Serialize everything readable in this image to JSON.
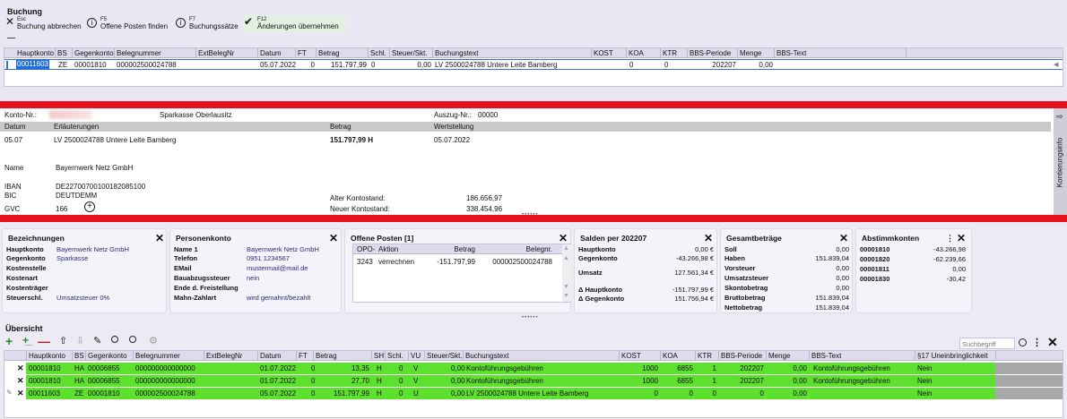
{
  "toolbar": {
    "section_title": "Buchung",
    "esc_key": "Esc",
    "esc_label": "Buchung abbrechen",
    "f5_key": "F5",
    "f5_label": "Offene Posten finden",
    "f7_key": "F7",
    "f7_label": "Buchungssätze",
    "f12_key": "F12",
    "f12_label": "Änderungen übernehmen"
  },
  "entry_grid": {
    "headers": [
      "Hauptkonto",
      "BS",
      "Gegenkonto",
      "Belegnummer",
      "ExtBelegNr",
      "Datum",
      "FT",
      "Betrag",
      "Schl.",
      "Steuer/Skt.",
      "Buchungstext",
      "KOST",
      "KOA",
      "KTR",
      "BBS-Periode",
      "Menge",
      "BBS-Text"
    ],
    "row": [
      "00011603",
      "ZE",
      "00001810",
      "000002500024788",
      "",
      "05.07.2022",
      "0",
      "151.797,99",
      "0",
      "0,00",
      "LV 2500024788 Untere Leite Bamberg",
      "",
      "0",
      "0",
      "202207",
      "0,00",
      ""
    ]
  },
  "statement": {
    "konto_label": "Konto-Nr.:",
    "bank": "Sparkasse Oberlausitz",
    "auszug_label": "Auszug-Nr.:",
    "auszug_value": "00000",
    "col_datum": "Datum",
    "col_erl": "Erläuterungen",
    "col_betrag": "Betrag",
    "col_wert": "Wertstellung",
    "date": "05.07",
    "text": "LV 2500024788 Untere Leite Bamberg",
    "amount": "151.797,99 H",
    "wert": "05.07.2022",
    "name_label": "Name",
    "name_value": "Bayernwerk Netz GmbH",
    "iban_label": "IBAN",
    "iban_value": "DE22700700100182085100",
    "bic_label": "BIC",
    "bic_value": "DEUTDEMM",
    "gvc_label": "GVC",
    "gvc_value": "166",
    "alter_label": "Alter Kontostand:",
    "alter_value": "186.656,97",
    "neuer_label": "Neuer Kontostand:",
    "neuer_value": "338.454,96",
    "side_tab": "Kontierungsinfo"
  },
  "panels": {
    "bez": {
      "title": "Bezeichnungen",
      "rows": [
        [
          "Hauptkonto",
          "Bayernwerk Netz GmbH"
        ],
        [
          "Gegenkonto",
          "Sparkasse"
        ],
        [
          "Kostenstelle",
          ""
        ],
        [
          "Kostenart",
          ""
        ],
        [
          "Kostenträger",
          ""
        ],
        [
          "Steuerschl.",
          "Umsatzsteuer 0%"
        ]
      ]
    },
    "pers": {
      "title": "Personenkonto",
      "rows": [
        [
          "Name 1",
          "Bayernwerk Netz GmbH"
        ],
        [
          "Telefon",
          "0951 1234567"
        ],
        [
          "EMail",
          "mustermail@mail.de"
        ],
        [
          "Bauabzugssteuer",
          "nein"
        ],
        [
          "Ende d. Freistellung",
          ""
        ],
        [
          "Mahn-Zahlart",
          "wird gemahnt/bezahlt"
        ]
      ]
    },
    "op": {
      "title": "Offene Posten [1]",
      "headers": [
        "OPO-",
        "Aktion",
        "Betrag",
        "Belegnr."
      ],
      "row": [
        "3243",
        "verrechnen",
        "-151.797,99",
        "000002500024788"
      ]
    },
    "sal": {
      "title": "Salden per 202207",
      "rows": [
        [
          "Hauptkonto",
          "0,00 €"
        ],
        [
          "Gegenkonto",
          "-43.266,98 €"
        ],
        [
          "Umsatz",
          "127.561,34 €"
        ],
        [
          "Δ Hauptkonto",
          "-151.797,99 €"
        ],
        [
          "Δ Gegenkonto",
          "151.756,94 €"
        ]
      ]
    },
    "ges": {
      "title": "Gesamtbeträge",
      "rows": [
        [
          "Soll",
          "0,00"
        ],
        [
          "Haben",
          "151.839,04"
        ],
        [
          "Vorsteuer",
          "0,00"
        ],
        [
          "Umsatzsteuer",
          "0,00"
        ],
        [
          "Skontobetrag",
          "0,00"
        ],
        [
          "Bruttobetrag",
          "151.839,04"
        ],
        [
          "Nettobetrag",
          "151.839,04"
        ]
      ]
    },
    "abs": {
      "title": "Abstimmkonten",
      "rows": [
        [
          "00001810",
          "-43.266,98"
        ],
        [
          "00001820",
          "-62.239,66"
        ],
        [
          "00001811",
          "0,00"
        ],
        [
          "00001830",
          "-30,42"
        ]
      ]
    }
  },
  "overview": {
    "title": "Übersicht",
    "search_placeholder": "Suchbegriff",
    "headers": [
      "Hauptkonto",
      "BS",
      "Gegenkonto",
      "Belegnummer",
      "ExtBelegNr",
      "Datum",
      "FT",
      "Betrag",
      "SH",
      "Schl.",
      "VU",
      "Steuer/Skt.",
      "Buchungstext",
      "KOST",
      "KOA",
      "KTR",
      "BBS-Periode",
      "Menge",
      "BBS-Text",
      "§17 Uneinbringlichkeit"
    ],
    "rows": [
      [
        "00001810",
        "HA",
        "00006855",
        "000000000000000",
        "",
        "01.07.2022",
        "0",
        "13,35",
        "H",
        "0",
        "V",
        "0,00",
        "Kontoführungsgebühren",
        "1000",
        "6855",
        "1",
        "202207",
        "0,00",
        "Kontoführungsgebühren",
        "Nein"
      ],
      [
        "00001810",
        "HA",
        "00006855",
        "000000000000000",
        "",
        "01.07.2022",
        "0",
        "27,70",
        "H",
        "0",
        "V",
        "0,00",
        "Kontoführungsgebühren",
        "1000",
        "6855",
        "1",
        "202207",
        "0,00",
        "Kontoführungsgebühren",
        "Nein"
      ],
      [
        "00011603",
        "ZE",
        "00001810",
        "000002500024788",
        "",
        "05.07.2022",
        "0",
        "151.797,99",
        "H",
        "0",
        "U",
        "0,00",
        "LV 2500024788 Untere Leite Bamberg",
        "0",
        "0",
        "0",
        "0",
        "0,00",
        "",
        "Nein"
      ]
    ]
  },
  "colors": {
    "red_bar": "#e8101a",
    "row_green": "#5ee02e",
    "selection": "#1e6fd9"
  }
}
